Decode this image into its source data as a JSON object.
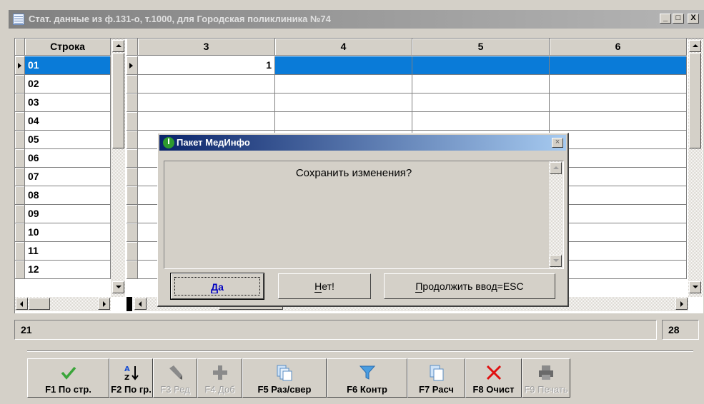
{
  "window": {
    "title": "Стат. данные из ф.131-о, т.1000, для Городская поликлиника №74",
    "minimize": "_",
    "maximize": "□",
    "close": "X"
  },
  "grid": {
    "left_header": "Строка",
    "columns": [
      "3",
      "4",
      "5",
      "6"
    ],
    "rows": [
      {
        "label": "01",
        "values": [
          "1",
          "",
          "",
          ""
        ],
        "selected": true
      },
      {
        "label": "02",
        "values": [
          "",
          "",
          "",
          ""
        ]
      },
      {
        "label": "03",
        "values": [
          "",
          "",
          "",
          ""
        ]
      },
      {
        "label": "04",
        "values": [
          "",
          "",
          "",
          ""
        ]
      },
      {
        "label": "05",
        "values": [
          "",
          "",
          "",
          ""
        ]
      },
      {
        "label": "06",
        "values": [
          "",
          "",
          "",
          ""
        ]
      },
      {
        "label": "07",
        "values": [
          "",
          "",
          "",
          ""
        ]
      },
      {
        "label": "08",
        "values": [
          "",
          "",
          "",
          ""
        ]
      },
      {
        "label": "09",
        "values": [
          "",
          "",
          "",
          ""
        ]
      },
      {
        "label": "10",
        "values": [
          "",
          "",
          "",
          ""
        ]
      },
      {
        "label": "11",
        "values": [
          "",
          "",
          "",
          ""
        ]
      },
      {
        "label": "12",
        "values": [
          "",
          "",
          "",
          ""
        ]
      }
    ]
  },
  "status": {
    "left_value": "21",
    "right_value": "28"
  },
  "toolbar": {
    "buttons": [
      {
        "label": "F1 По стр.",
        "icon": "check-icon",
        "enabled": true
      },
      {
        "label": "F2 По гр.",
        "icon": "sort-az-icon",
        "enabled": true
      },
      {
        "label": "F3 Ред",
        "icon": "pencil-icon",
        "enabled": false
      },
      {
        "label": "F4 Доб",
        "icon": "plus-icon",
        "enabled": false
      },
      {
        "label": "F5 Раз/свер",
        "icon": "pages-icon",
        "enabled": true
      },
      {
        "label": "F6 Контр",
        "icon": "filter-icon",
        "enabled": true
      },
      {
        "label": "F7 Расч",
        "icon": "calc-pages-icon",
        "enabled": true
      },
      {
        "label": "F8 Очист",
        "icon": "red-x-icon",
        "enabled": true
      },
      {
        "label": "F9 Печать",
        "icon": "printer-icon",
        "enabled": false
      }
    ]
  },
  "dialog": {
    "title": "Пакет МедИнфо",
    "close": "×",
    "message": "Сохранить изменения?",
    "buttons": {
      "yes": {
        "accel": "Д",
        "rest": "а"
      },
      "no": {
        "accel": "Н",
        "rest": "ет!"
      },
      "continue": {
        "accel": "П",
        "rest": "родолжить ввод=ESC"
      }
    }
  },
  "colors": {
    "selection": "#0a7bd8",
    "dialog_title_start": "#0a246a",
    "dialog_title_end": "#a6caf0",
    "face": "#d4d0c8"
  }
}
